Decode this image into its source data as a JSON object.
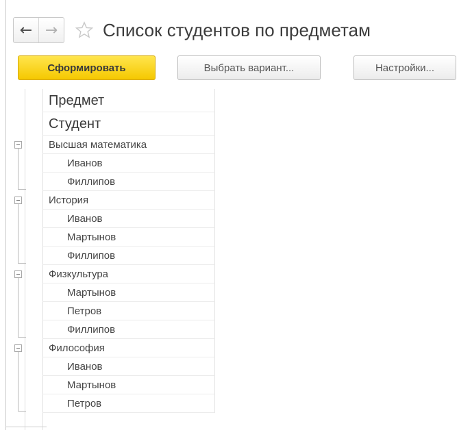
{
  "header": {
    "back_icon": "arrow-left-icon",
    "forward_icon": "arrow-right-icon",
    "favorite_icon": "star-icon",
    "title": "Список студентов по предметам"
  },
  "toolbar": {
    "generate_label": "Сформировать",
    "select_variant_label": "Выбрать вариант...",
    "settings_label": "Настройки...",
    "accent_color": "#f5c800"
  },
  "report": {
    "header_col1": "Предмет",
    "header_col2": "Студент",
    "groups": [
      {
        "subject": "Высшая математика",
        "students": [
          "Иванов",
          "Филлипов"
        ]
      },
      {
        "subject": "История",
        "students": [
          "Иванов",
          "Мартынов",
          "Филлипов"
        ]
      },
      {
        "subject": "Физкультура",
        "students": [
          "Мартынов",
          "Петров",
          "Филлипов"
        ]
      },
      {
        "subject": "Философия",
        "students": [
          "Иванов",
          "Мартынов",
          "Петров"
        ]
      }
    ]
  }
}
